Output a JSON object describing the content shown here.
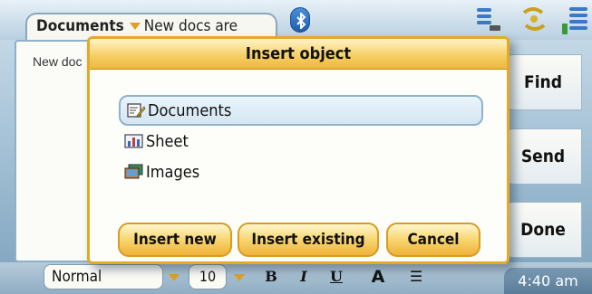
{
  "tab": {
    "title": "Documents",
    "subtitle": "New docs are"
  },
  "status_icons": [
    "bluetooth-icon",
    "keyboard-signal-icon",
    "connectivity-icon",
    "battery-icon"
  ],
  "document": {
    "text": "New doc"
  },
  "dialog": {
    "title": "Insert object",
    "items": [
      {
        "label": "Documents",
        "icon": "document-edit-icon",
        "selected": true
      },
      {
        "label": "Sheet",
        "icon": "spreadsheet-icon",
        "selected": false
      },
      {
        "label": "Images",
        "icon": "images-icon",
        "selected": false
      }
    ],
    "buttons": {
      "insert_new": "Insert new",
      "insert_existing": "Insert existing",
      "cancel": "Cancel"
    }
  },
  "softkeys": {
    "find": "Find",
    "send": "Send",
    "done": "Done"
  },
  "toolbar": {
    "style": "Normal",
    "size": "10",
    "bold": "B",
    "italic": "I",
    "underline": "U",
    "font_color": "A",
    "list": "☰"
  },
  "clock": "4:40 am",
  "colors": {
    "accent": "#ecb83a",
    "frame": "#8fb0c6",
    "selection": "#d4e6f2"
  }
}
